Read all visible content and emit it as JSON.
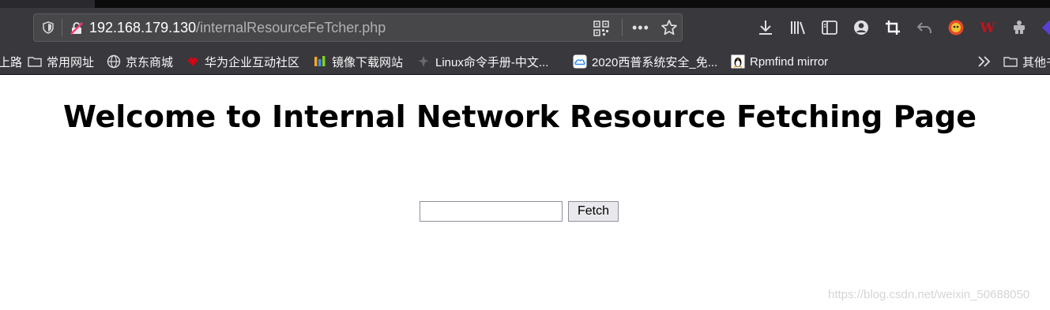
{
  "browser": {
    "url_host": "192.168.179.130",
    "url_path": "/internalResourceFeTcher.php",
    "icons": [
      "shield-icon",
      "insecure-connection-icon",
      "qr-code-icon",
      "more-actions-icon",
      "bookmark-star-icon",
      "download-icon",
      "library-icon",
      "sidebar-icon",
      "account-icon",
      "screenshot-icon",
      "undo-icon",
      "extension-icon",
      "extension-w-icon",
      "extension-puzzle-icon"
    ]
  },
  "bookmarks": {
    "items": [
      {
        "label": "上路",
        "icon": "none"
      },
      {
        "label": "常用网址",
        "icon": "folder-icon"
      },
      {
        "label": "京东商城",
        "icon": "globe-icon"
      },
      {
        "label": "华为企业互动社区",
        "icon": "huawei-icon"
      },
      {
        "label": "镜像下载网站",
        "icon": "mirror-icon"
      },
      {
        "label": "Linux命令手册-中文...",
        "icon": "linux-icon"
      },
      {
        "label": "2020西普系统安全_免...",
        "icon": "cloud-icon"
      },
      {
        "label": "Rpmfind mirror",
        "icon": "penguin-icon"
      },
      {
        "label": "其他书",
        "icon": "folder-icon"
      }
    ]
  },
  "page": {
    "heading": "Welcome to Internal Network Resource Fetching Page",
    "input_value": "",
    "fetch_label": "Fetch"
  },
  "watermark": "https://blog.csdn.net/weixin_50688050",
  "colors": {
    "toolbar_bg": "#38383d",
    "urlbar_bg": "#474749",
    "page_bg": "#ffffff"
  }
}
